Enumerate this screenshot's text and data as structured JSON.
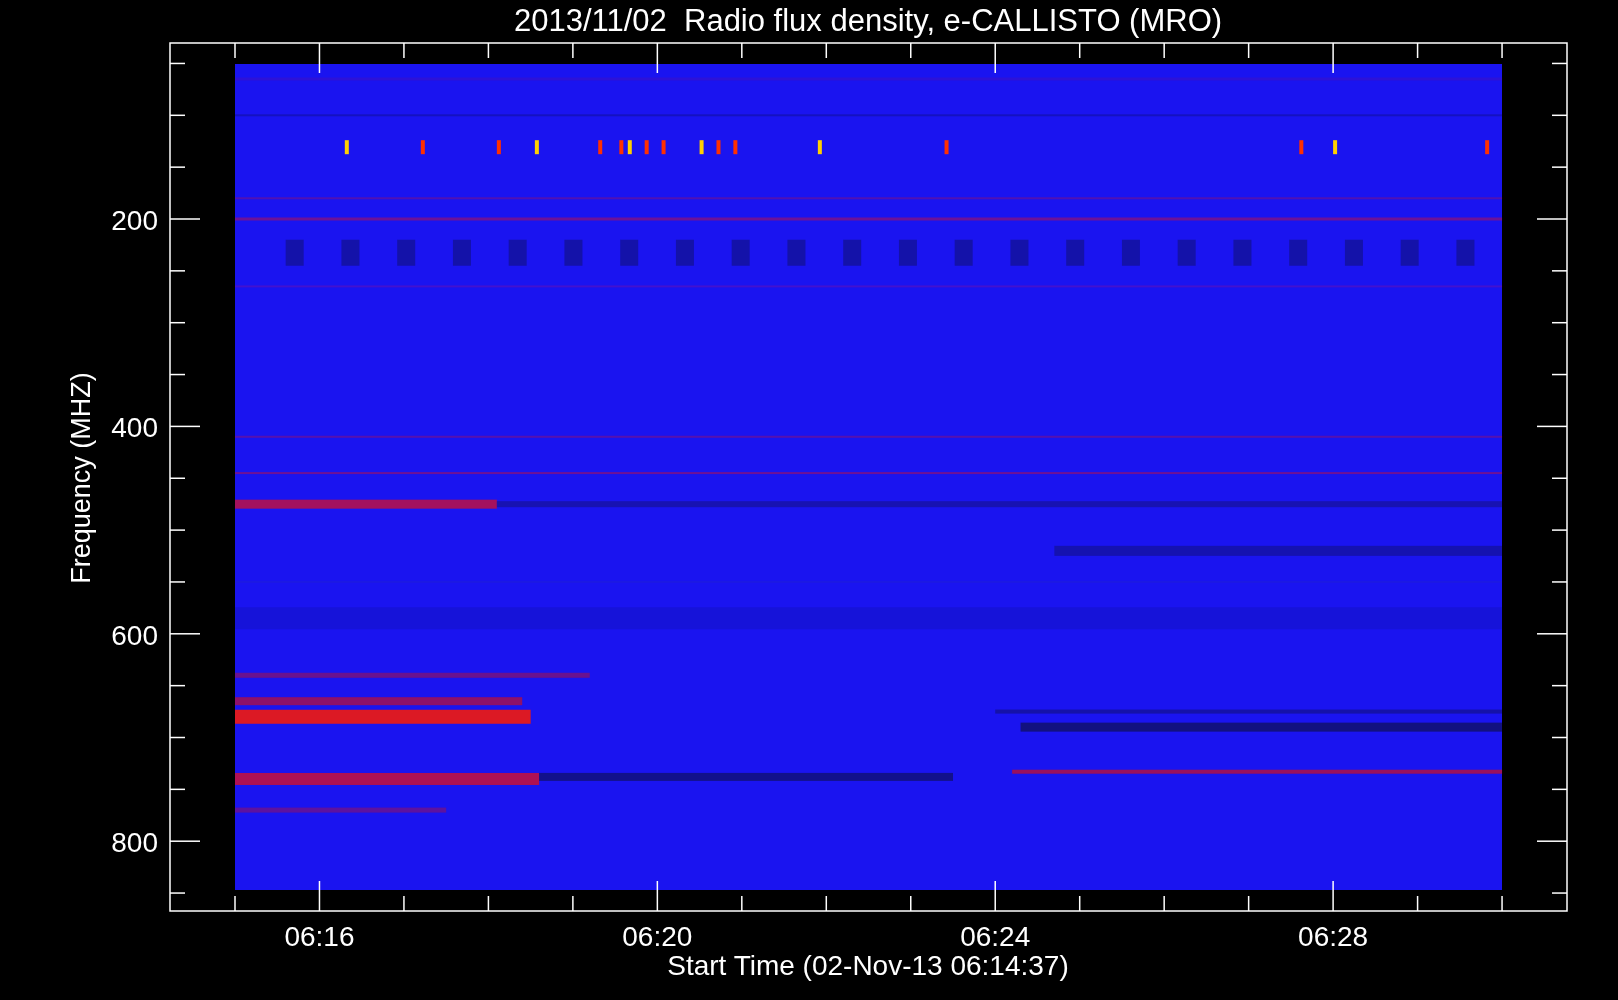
{
  "title": "2013/11/02  Radio flux density, e-CALLISTO (MRO)",
  "y_axis": {
    "label": "Frequency (MHZ)",
    "tick_labels": [
      "200",
      "400",
      "600",
      "800"
    ]
  },
  "x_axis": {
    "label": "Start Time (02-Nov-13 06:14:37)",
    "tick_labels": [
      "06:16",
      "06:20",
      "06:24",
      "06:28"
    ]
  }
}
